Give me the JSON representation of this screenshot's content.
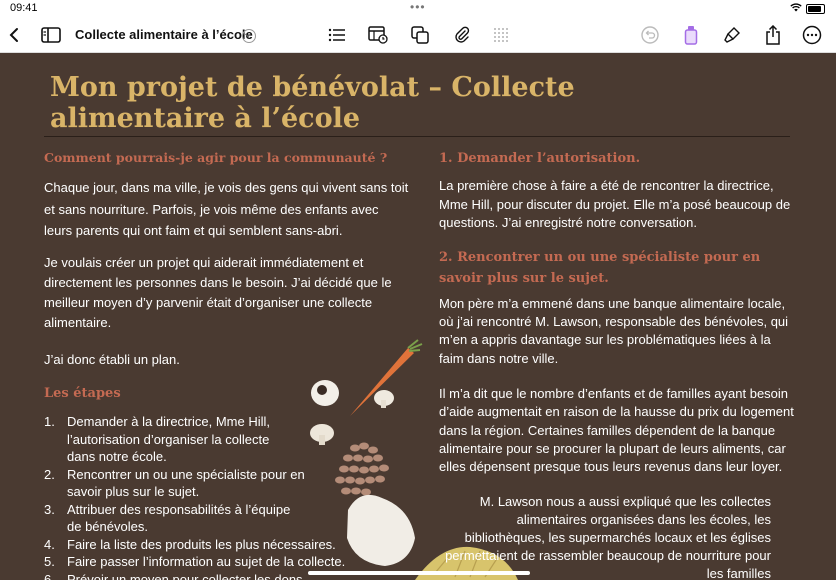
{
  "status": {
    "time": "09:41"
  },
  "toolbar": {
    "title": "Collecte alimentaire à l’école"
  },
  "doc": {
    "title": "Mon projet de bénévolat – Collecte alimentaire à l’école",
    "left": {
      "q_heading": "Comment pourrais-je agir pour la communauté ?",
      "p1": "Chaque jour, dans ma ville, je vois des gens qui vivent sans toit et sans nourriture. Parfois, je vois même des enfants avec leurs parents qui ont faim et qui semblent sans-abri.",
      "p2": "Je voulais créer un projet qui aiderait immédiatement et directement les personnes dans le besoin. J’ai décidé que le meilleur moyen d’y parvenir était d’organiser une collecte alimentaire.",
      "p3": "J’ai donc établi un plan.",
      "steps_heading": "Les étapes",
      "steps": [
        {
          "num": "1.",
          "text": "Demander à la directrice, Mme Hill, l’autorisation d’organiser la collecte dans notre école."
        },
        {
          "num": "2.",
          "text": "Rencontrer un ou une spécialiste pour en savoir plus sur le sujet."
        },
        {
          "num": "3.",
          "text": "Attribuer des responsabilités à l’équipe de bénévoles."
        },
        {
          "num": "4.",
          "text": "Faire la liste des produits les plus nécessaires."
        },
        {
          "num": "5.",
          "text": "Faire passer l’information au sujet de la collecte."
        },
        {
          "num": "6.",
          "text": "Prévoir un moyen pour collecter les dons."
        }
      ]
    },
    "right": {
      "h1": "1. Demander l’autorisation.",
      "p1": "La première chose à faire a été de rencontrer la directrice, Mme Hill, pour discuter du projet. Elle m’a posé beaucoup de questions. J’ai enregistré notre conversation.",
      "h2": "2. Rencontrer un ou une spécialiste pour en savoir plus sur le sujet.",
      "p2": "Mon père m’a emmené dans une banque alimentaire locale, où j’ai rencontré M. Lawson, responsable des bénévoles, qui m’en a appris davantage sur les problématiques liées à la faim dans notre ville.",
      "p3": "Il m’a dit que le nombre d’enfants et de familles ayant besoin d’aide augmentait en raison de la hausse du prix du logement dans la région. Certaines familles dépendent de la banque alimentaire pour se procurer la plupart de leurs aliments, car elles dépensent presque tous leurs revenus dans leur loyer.",
      "p4": "M. Lawson nous a aussi expliqué que les collectes alimentaires organisées dans les écoles, les bibliothèques, les supermarchés locaux et les églises permettaient de rassembler beaucoup de nourriture pour les familles"
    }
  }
}
